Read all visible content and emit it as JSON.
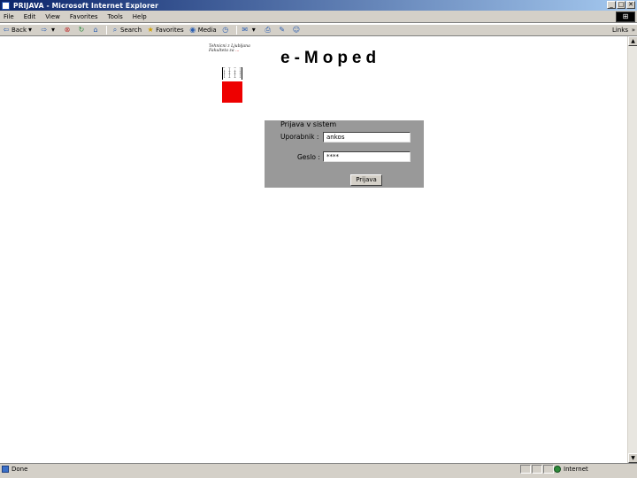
{
  "window": {
    "title": "PRIJAVA - Microsoft Internet Explorer",
    "controls": [
      "_",
      "□",
      "✕"
    ]
  },
  "menu": [
    "File",
    "Edit",
    "View",
    "Favorites",
    "Tools",
    "Help"
  ],
  "toolbar": {
    "back": "Back",
    "forward_icon": "forward-arrow-icon",
    "search": "Search",
    "favorites": "Favorites",
    "media": "Media",
    "links": "Links",
    "links_chevron": "»"
  },
  "logo": {
    "line1": "Tehnicni z Ljubljana",
    "line2_a": "Fakulteta za",
    "line2_b": "..."
  },
  "app_title": "e-Moped",
  "login": {
    "heading": "Prijava v sistem",
    "username_label": "Uporabnik :",
    "username_value": "ankos",
    "password_label": "Geslo :",
    "password_value": "****",
    "submit_label": "Prijava"
  },
  "status": {
    "text": "Done",
    "zone": "Internet"
  }
}
